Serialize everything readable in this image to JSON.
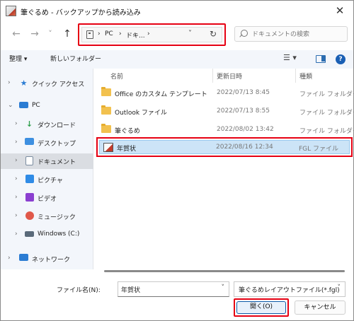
{
  "window": {
    "title": "筆ぐるめ - バックアップから読み込み",
    "close": "✕"
  },
  "nav": {
    "back": "←",
    "forward": "→",
    "recent": "˅",
    "up": "↑"
  },
  "address": {
    "crumbs": [
      "›",
      "PC",
      "›",
      "ドキ...",
      "›"
    ],
    "dropdown": "˅",
    "refresh": "↻"
  },
  "search": {
    "placeholder": "ドキュメントの検索"
  },
  "toolbar": {
    "organize": "整理 ▾",
    "new_folder": "新しいフォルダー",
    "view": "☰ ▾"
  },
  "help": "?",
  "sidebar": {
    "items": [
      {
        "label": "クイック アクセス",
        "icon": "star-icon",
        "color": "#2b7cd3"
      },
      {
        "label": "PC",
        "icon": "pc-icon",
        "color": "#2b7cd3"
      },
      {
        "label": "ダウンロード",
        "icon": "download-icon",
        "color": "#2d9d4a"
      },
      {
        "label": "デスクトップ",
        "icon": "desktop-icon",
        "color": "#3d8fe0"
      },
      {
        "label": "ドキュメント",
        "icon": "documents-icon",
        "color": "#7a8ca0"
      },
      {
        "label": "ピクチャ",
        "icon": "pictures-icon",
        "color": "#2f8be6"
      },
      {
        "label": "ビデオ",
        "icon": "videos-icon",
        "color": "#8b3fd0"
      },
      {
        "label": "ミュージック",
        "icon": "music-icon",
        "color": "#e0584a"
      },
      {
        "label": "Windows (C:)",
        "icon": "drive-icon",
        "color": "#5a6a7a"
      },
      {
        "label": "ネットワーク",
        "icon": "network-icon",
        "color": "#2b7cd3"
      }
    ]
  },
  "list": {
    "headers": {
      "name": "名前",
      "modified": "更新日時",
      "type": "種類"
    },
    "rows": [
      {
        "name": "Office のカスタム テンプレート",
        "date": "2022/07/13 8:45",
        "type": "ファイル フォルダー"
      },
      {
        "name": "Outlook ファイル",
        "date": "2022/07/13 8:55",
        "type": "ファイル フォルダー"
      },
      {
        "name": "筆ぐるめ",
        "date": "2022/08/02 13:42",
        "type": "ファイル フォルダー"
      },
      {
        "name": "年賀状",
        "date": "2022/08/16 12:34",
        "type": "FGL ファイル"
      }
    ]
  },
  "footer": {
    "filename_label": "ファイル名(N):",
    "filename_value": "年賀状",
    "filetype": "筆ぐるめレイアウトファイル(*.fgl)",
    "dropdown": "˅",
    "open": "開く(O)",
    "cancel": "キャンセル"
  },
  "colors": {
    "highlight_frame": "#e60012",
    "selection": "#cce4f7",
    "accent": "#0d5aa7"
  }
}
